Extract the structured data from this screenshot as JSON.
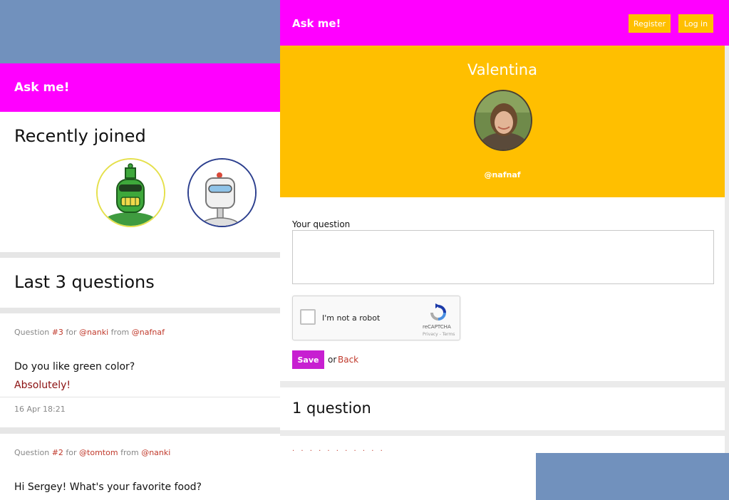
{
  "back_window": {
    "brand": "Ask me!",
    "recent": {
      "title": "Recently joined",
      "avatars": [
        {
          "icon": "green-robot-avatar",
          "ring_color": "#e5e04b"
        },
        {
          "icon": "white-robot-avatar",
          "ring_color": "#2c3f8e"
        }
      ]
    },
    "last": {
      "title": "Last 3 questions"
    },
    "questions": [
      {
        "prefix": "Question",
        "number": "#3",
        "for_word": "for",
        "to_user": "@nanki",
        "from_word": "from",
        "from_user": "@nafnaf",
        "text": "Do you like green color?",
        "answer": "Absolutely!",
        "date": "16 Apr 18:21"
      },
      {
        "prefix": "Question",
        "number": "#2",
        "for_word": "for",
        "to_user": "@tomtom",
        "from_word": "from",
        "from_user": "@nanki",
        "text": "Hi Sergey! What's your favorite food?"
      }
    ]
  },
  "front_window": {
    "brand": "Ask me!",
    "nav": {
      "register": "Register",
      "login": "Log in"
    },
    "profile": {
      "name": "Valentina",
      "handle": "@nafnaf"
    },
    "form": {
      "label": "Your question",
      "value": "",
      "captcha_label": "I'm not a robot",
      "captcha_brand": "reCAPTCHA",
      "captcha_terms": "Privacy - Terms",
      "save": "Save",
      "or_text": "or",
      "back": "Back"
    },
    "count_title": "1 question"
  },
  "colors": {
    "accent": "#ff00ff",
    "highlight": "#ffbf00",
    "button": "#c71fd1",
    "link": "#c0392b"
  }
}
